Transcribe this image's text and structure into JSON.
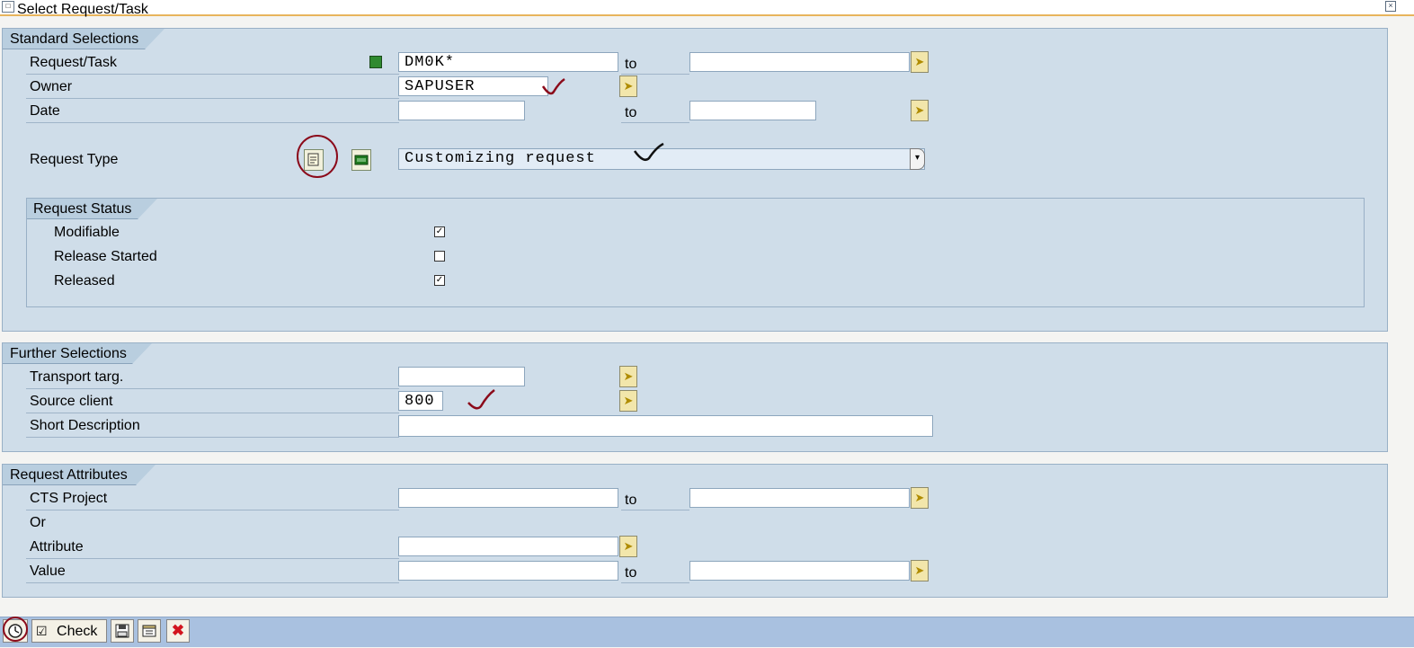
{
  "window": {
    "title": "Select Request/Task"
  },
  "standard_selections": {
    "title": "Standard Selections",
    "request_task": {
      "label": "Request/Task",
      "value": "DM0K*",
      "to_label": "to",
      "to_value": ""
    },
    "owner": {
      "label": "Owner",
      "value": "SAPUSER"
    },
    "date": {
      "label": "Date",
      "value": "",
      "to_label": "to",
      "to_value": ""
    },
    "request_type": {
      "label": "Request Type",
      "value": "Customizing request"
    },
    "request_status": {
      "title": "Request Status",
      "items": [
        {
          "label": "Modifiable",
          "checked": true
        },
        {
          "label": "Release Started",
          "checked": false
        },
        {
          "label": "Released",
          "checked": true
        }
      ]
    }
  },
  "further_selections": {
    "title": "Further Selections",
    "transport_target": {
      "label": "Transport targ.",
      "value": ""
    },
    "source_client": {
      "label": "Source client",
      "value": "800"
    },
    "short_description": {
      "label": "Short Description",
      "value": ""
    }
  },
  "request_attributes": {
    "title": "Request Attributes",
    "cts_project": {
      "label": "CTS Project",
      "value": "",
      "to_label": "to",
      "to_value": ""
    },
    "or_label": "Or",
    "attribute": {
      "label": "Attribute",
      "value": ""
    },
    "value": {
      "label": "Value",
      "value": "",
      "to_label": "to",
      "to_value": ""
    }
  },
  "toolbar": {
    "check_label": "Check"
  },
  "icons": {
    "multiple_selection": "arrow-right-icon",
    "execute": "clock-execute-icon",
    "save": "save-icon",
    "variant": "variant-icon",
    "cancel": "cancel-icon"
  },
  "colors": {
    "group_background": "#cfdde9",
    "toolbar_background": "#a9c1e0",
    "title_accent": "#e8b45c",
    "annotation_red": "#8b0a1a"
  }
}
